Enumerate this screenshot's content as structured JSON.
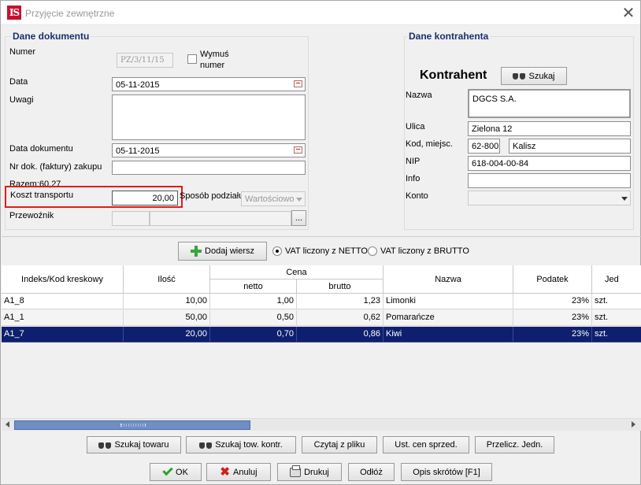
{
  "window": {
    "title": "Przyjęcie zewnętrzne",
    "logo_text": "IS",
    "close_glyph": "✕"
  },
  "doc": {
    "section_title": "Dane dokumentu",
    "numer_label": "Numer",
    "numer_value": "PZ/3/11/15",
    "wymus_label_1": "Wymuś",
    "wymus_label_2": "numer",
    "data_label": "Data",
    "data_value": "05-11-2015",
    "uwagi_label": "Uwagi",
    "uwagi_value": "",
    "data_dok_label": "Data dokumentu",
    "data_dok_value": "05-11-2015",
    "nr_dok_label": "Nr dok. (faktury) zakupu",
    "nr_dok_value": "",
    "razem_label": "Razem:60,27",
    "koszt_label": "Koszt transportu",
    "koszt_value": "20,00",
    "sposob_label": "Sposób podziału",
    "sposob_value": "Wartościowo",
    "przewoznik_label": "Przewoźnik",
    "przewoznik_value": "",
    "ellipsis": "..."
  },
  "kontr": {
    "section_title": "Dane kontrahenta",
    "heading": "Kontrahent",
    "szukaj_label": "Szukaj",
    "nazwa_label": "Nazwa",
    "nazwa_value": "DGCS S.A.",
    "ulica_label": "Ulica",
    "ulica_value": "Zielona 12",
    "kod_label": "Kod, miejsc.",
    "kod_value": "62-800",
    "miasto_value": "Kalisz",
    "nip_label": "NIP",
    "nip_value": "618-004-00-84",
    "info_label": "Info",
    "info_value": "",
    "konto_label": "Konto",
    "konto_value": ""
  },
  "toolbar": {
    "dodaj_label": "Dodaj wiersz",
    "vat_netto_label": "VAT liczony z NETTO",
    "vat_brutto_label": "VAT liczony z BRUTTO"
  },
  "table": {
    "headers": {
      "indeks": "Indeks/Kod kreskowy",
      "ilosc": "Ilość",
      "cena": "Cena",
      "netto": "netto",
      "brutto": "brutto",
      "nazwa": "Nazwa",
      "podatek": "Podatek",
      "jed": "Jed"
    },
    "rows": [
      {
        "indeks": "A1_8",
        "ilosc": "10,00",
        "netto": "1,00",
        "brutto": "1,23",
        "nazwa": "Limonki",
        "podatek": "23%",
        "jed": "szt."
      },
      {
        "indeks": "A1_1",
        "ilosc": "50,00",
        "netto": "0,50",
        "brutto": "0,62",
        "nazwa": "Pomarańcze",
        "podatek": "23%",
        "jed": "szt."
      },
      {
        "indeks": "A1_7",
        "ilosc": "20,00",
        "netto": "0,70",
        "brutto": "0,86",
        "nazwa": "Kiwi",
        "podatek": "23%",
        "jed": "szt."
      }
    ],
    "selected_row": 2
  },
  "buttons1": {
    "szukaj_towaru": "Szukaj towaru",
    "szukaj_tow_kontr": "Szukaj tow. kontr.",
    "czytaj": "Czytaj z pliku",
    "ust_cen": "Ust. cen sprzed.",
    "przelicz": "Przelicz. Jedn."
  },
  "buttons2": {
    "ok": "OK",
    "anuluj": "Anuluj",
    "drukuj": "Drukuj",
    "odloz": "Odłóż",
    "opis": "Opis skrótów [F1]"
  },
  "colors": {
    "accent": "#1d2f6b",
    "selection": "#0d1f6e",
    "highlight": "#e21b1b",
    "logo": "#c8102e"
  }
}
